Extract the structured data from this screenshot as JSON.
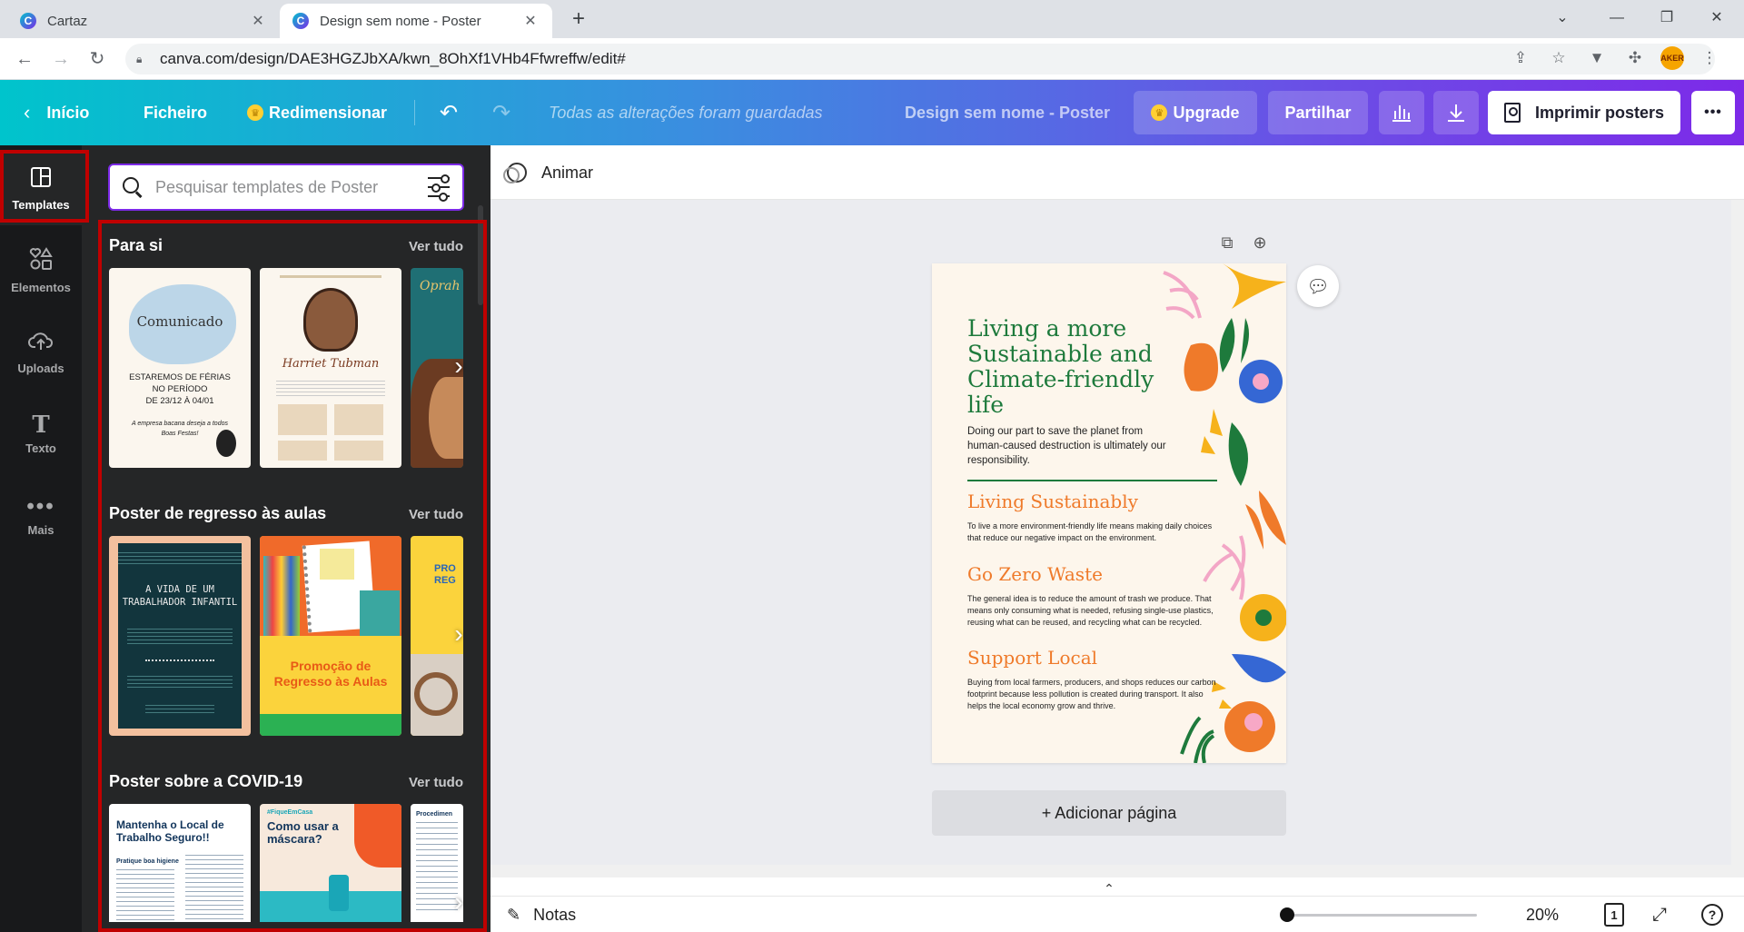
{
  "browser": {
    "tabs": [
      {
        "title": "Cartaz",
        "icon": "canva-favicon"
      },
      {
        "title": "Design sem nome - Poster",
        "icon": "canva-favicon"
      }
    ],
    "url": "canva.com/design/DAE3HGZJbXA/kwn_8OhXf1VHb4Ffwreffw/edit#",
    "profile_badge": "AKER"
  },
  "header": {
    "home_label": "Início",
    "file_label": "Ficheiro",
    "resize_label": "Redimensionar",
    "saved_status": "Todas as alterações foram guardadas",
    "design_title": "Design sem nome - Poster",
    "upgrade_label": "Upgrade",
    "share_label": "Partilhar",
    "print_label": "Imprimir posters",
    "more_label": "•••"
  },
  "rail": {
    "items": [
      {
        "label": "Templates",
        "icon": "templates-icon"
      },
      {
        "label": "Elementos",
        "icon": "elements-icon"
      },
      {
        "label": "Uploads",
        "icon": "upload-cloud-icon"
      },
      {
        "label": "Texto",
        "icon": "text-icon"
      },
      {
        "label": "Mais",
        "icon": "more-dots-icon"
      }
    ]
  },
  "panel": {
    "search_placeholder": "Pesquisar templates de Poster",
    "see_all": "Ver tudo",
    "sections": [
      {
        "title": "Para si",
        "thumbs": [
          {
            "lines": [
              "Comunicado",
              "ESTAREMOS DE FÉRIAS",
              "NO PERÍODO",
              "DE 23/12 À 04/01",
              "A empresa bacana deseja a todos",
              "Boas Festas!"
            ]
          },
          {
            "lines": [
              "Harriet Tubman"
            ]
          },
          {
            "lines": [
              "Oprah"
            ]
          }
        ]
      },
      {
        "title": "Poster de regresso às aulas",
        "thumbs": [
          {
            "lines": [
              "A VIDA DE UM",
              "TRABALHADOR INFANTIL"
            ]
          },
          {
            "lines": [
              "Promoção de",
              "Regresso às Aulas"
            ]
          },
          {
            "lines": [
              "PRO",
              "REG"
            ]
          }
        ]
      },
      {
        "title": "Poster sobre a COVID-19",
        "thumbs": [
          {
            "lines": [
              "Mantenha o Local de",
              "Trabalho Seguro!!",
              "Pratique boa higiene"
            ]
          },
          {
            "lines": [
              "#FiqueEmCasa",
              "Como usar a",
              "máscara?"
            ]
          },
          {
            "lines": [
              "Procedimen"
            ]
          }
        ]
      }
    ]
  },
  "editor": {
    "animate_label": "Animar",
    "add_page_label": "+ Adicionar página",
    "notes_label": "Notas",
    "zoom_label": "20%",
    "zoom_fraction": 0.0,
    "page_count": "1",
    "help_label": "?"
  },
  "poster": {
    "title": "Living a more Sustainable and Climate-friendly life",
    "subtitle": "Doing our part to save the planet from human-caused destruction is ultimately our responsibility.",
    "sections": [
      {
        "heading": "Living Sustainably",
        "text": "To live a more environment-friendly life means making daily choices that reduce our negative impact on the environment."
      },
      {
        "heading": "Go Zero Waste",
        "text": "The general idea is to reduce the amount of trash we produce. That means only consuming what is needed, refusing single-use plastics, reusing what can be reused, and recycling what can be recycled."
      },
      {
        "heading": "Support Local",
        "text": "Buying from local farmers, producers, and shops reduces our carbon footprint because less pollution is created during transport. It also helps the local economy grow and thrive."
      }
    ]
  },
  "colors": {
    "header_start": "#00c4cc",
    "header_end": "#7d2ae8",
    "highlight_red": "#c00000",
    "poster_green": "#1e7a3c",
    "poster_orange": "#ef7a2a"
  }
}
